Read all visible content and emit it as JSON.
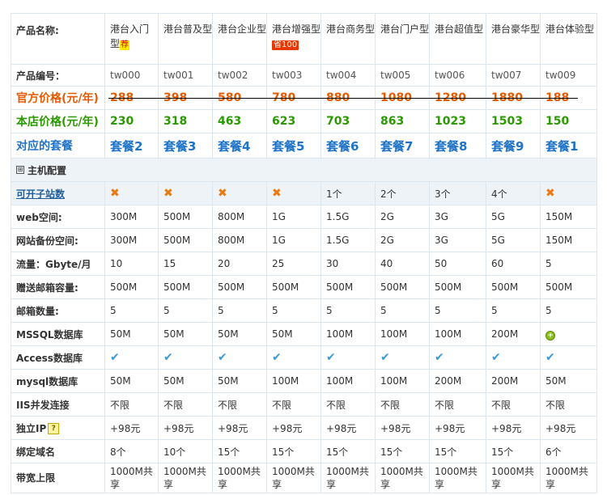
{
  "labels": {
    "name": "产品名称:",
    "code": "产品编号：",
    "official": "官方价格(元/年)",
    "store": "本店价格(元/年)",
    "plan": "对应的套餐",
    "section": "主机配置",
    "sites": "可开子站数",
    "web": "web空间:",
    "backup": "网站备份空间:",
    "traffic": "流量：Gbyte/月",
    "gift_mail": "赠送邮箱容量:",
    "mail_count": "邮箱数量:",
    "mssql": "MSSQL数据库",
    "access": "Access数据库",
    "mysql": "mysql数据库",
    "iis": "IIS并发连接",
    "ip": "独立IP",
    "domains": "绑定域名",
    "bandwidth": "带宽上限"
  },
  "icons": {
    "section_toggle": "⊞",
    "help": "?"
  },
  "products": [
    {
      "name": "港台入门型",
      "badge": "荐",
      "badge_type": "rec",
      "code": "tw000",
      "official": "288",
      "store": "230",
      "plan": "套餐2",
      "sites": {
        "type": "x"
      },
      "web": "300M",
      "backup": "300M",
      "traffic": "10",
      "gift_mail": "500M",
      "mail_count": "5",
      "mssql": {
        "type": "text",
        "text": "50M"
      },
      "access": {
        "type": "check"
      },
      "mysql": "50M",
      "iis": "不限",
      "ip": "+98元",
      "domains": "8个",
      "bandwidth": "1000M共享"
    },
    {
      "name": "港台普及型",
      "badge": "",
      "badge_type": "",
      "code": "tw001",
      "official": "398",
      "store": "318",
      "plan": "套餐3",
      "sites": {
        "type": "x"
      },
      "web": "500M",
      "backup": "500M",
      "traffic": "15",
      "gift_mail": "500M",
      "mail_count": "5",
      "mssql": {
        "type": "text",
        "text": "50M"
      },
      "access": {
        "type": "check"
      },
      "mysql": "50M",
      "iis": "不限",
      "ip": "+98元",
      "domains": "10个",
      "bandwidth": "1000M共享"
    },
    {
      "name": "港台企业型",
      "badge": "",
      "badge_type": "",
      "code": "tw002",
      "official": "580",
      "store": "463",
      "plan": "套餐4",
      "sites": {
        "type": "x"
      },
      "web": "800M",
      "backup": "800M",
      "traffic": "20",
      "gift_mail": "500M",
      "mail_count": "5",
      "mssql": {
        "type": "text",
        "text": "50M"
      },
      "access": {
        "type": "check"
      },
      "mysql": "50M",
      "iis": "不限",
      "ip": "+98元",
      "domains": "15个",
      "bandwidth": "1000M共享"
    },
    {
      "name": "港台增强型",
      "badge": "省100",
      "badge_type": "save",
      "code": "tw003",
      "official": "780",
      "store": "623",
      "plan": "套餐5",
      "sites": {
        "type": "x"
      },
      "web": "1G",
      "backup": "1G",
      "traffic": "25",
      "gift_mail": "500M",
      "mail_count": "5",
      "mssql": {
        "type": "text",
        "text": "50M"
      },
      "access": {
        "type": "check"
      },
      "mysql": "100M",
      "iis": "不限",
      "ip": "+98元",
      "domains": "15个",
      "bandwidth": "1000M共享"
    },
    {
      "name": "港台商务型",
      "badge": "",
      "badge_type": "",
      "code": "tw004",
      "official": "880",
      "store": "703",
      "plan": "套餐6",
      "sites": {
        "type": "text",
        "text": "1个"
      },
      "web": "1.5G",
      "backup": "1.5G",
      "traffic": "30",
      "gift_mail": "500M",
      "mail_count": "5",
      "mssql": {
        "type": "text",
        "text": "100M"
      },
      "access": {
        "type": "check"
      },
      "mysql": "100M",
      "iis": "不限",
      "ip": "+98元",
      "domains": "15个",
      "bandwidth": "1000M共享"
    },
    {
      "name": "港台门户型",
      "badge": "",
      "badge_type": "",
      "code": "tw005",
      "official": "1080",
      "store": "863",
      "plan": "套餐7",
      "sites": {
        "type": "text",
        "text": "2个"
      },
      "web": "2G",
      "backup": "2G",
      "traffic": "40",
      "gift_mail": "500M",
      "mail_count": "5",
      "mssql": {
        "type": "text",
        "text": "100M"
      },
      "access": {
        "type": "check"
      },
      "mysql": "100M",
      "iis": "不限",
      "ip": "+98元",
      "domains": "15个",
      "bandwidth": "1000M共享"
    },
    {
      "name": "港台超值型",
      "badge": "",
      "badge_type": "",
      "code": "tw006",
      "official": "1280",
      "store": "1023",
      "plan": "套餐8",
      "sites": {
        "type": "text",
        "text": "3个"
      },
      "web": "3G",
      "backup": "3G",
      "traffic": "50",
      "gift_mail": "500M",
      "mail_count": "5",
      "mssql": {
        "type": "text",
        "text": "100M"
      },
      "access": {
        "type": "check"
      },
      "mysql": "200M",
      "iis": "不限",
      "ip": "+98元",
      "domains": "15个",
      "bandwidth": "1000M共享"
    },
    {
      "name": "港台豪华型",
      "badge": "",
      "badge_type": "",
      "code": "tw007",
      "official": "1880",
      "store": "1503",
      "plan": "套餐9",
      "sites": {
        "type": "text",
        "text": "4个"
      },
      "web": "5G",
      "backup": "5G",
      "traffic": "60",
      "gift_mail": "500M",
      "mail_count": "5",
      "mssql": {
        "type": "text",
        "text": "200M"
      },
      "access": {
        "type": "check"
      },
      "mysql": "200M",
      "iis": "不限",
      "ip": "+98元",
      "domains": "15个",
      "bandwidth": "1000M共享"
    },
    {
      "name": "港台体验型",
      "badge": "",
      "badge_type": "",
      "code": "tw009",
      "official": "188",
      "store": "150",
      "plan": "套餐1",
      "sites": {
        "type": "x"
      },
      "web": "150M",
      "backup": "150M",
      "traffic": "5",
      "gift_mail": "500M",
      "mail_count": "5",
      "mssql": {
        "type": "plus"
      },
      "access": {
        "type": "check"
      },
      "mysql": "50M",
      "iis": "不限",
      "ip": "+98元",
      "domains": "6个",
      "bandwidth": "1000M共享"
    }
  ]
}
